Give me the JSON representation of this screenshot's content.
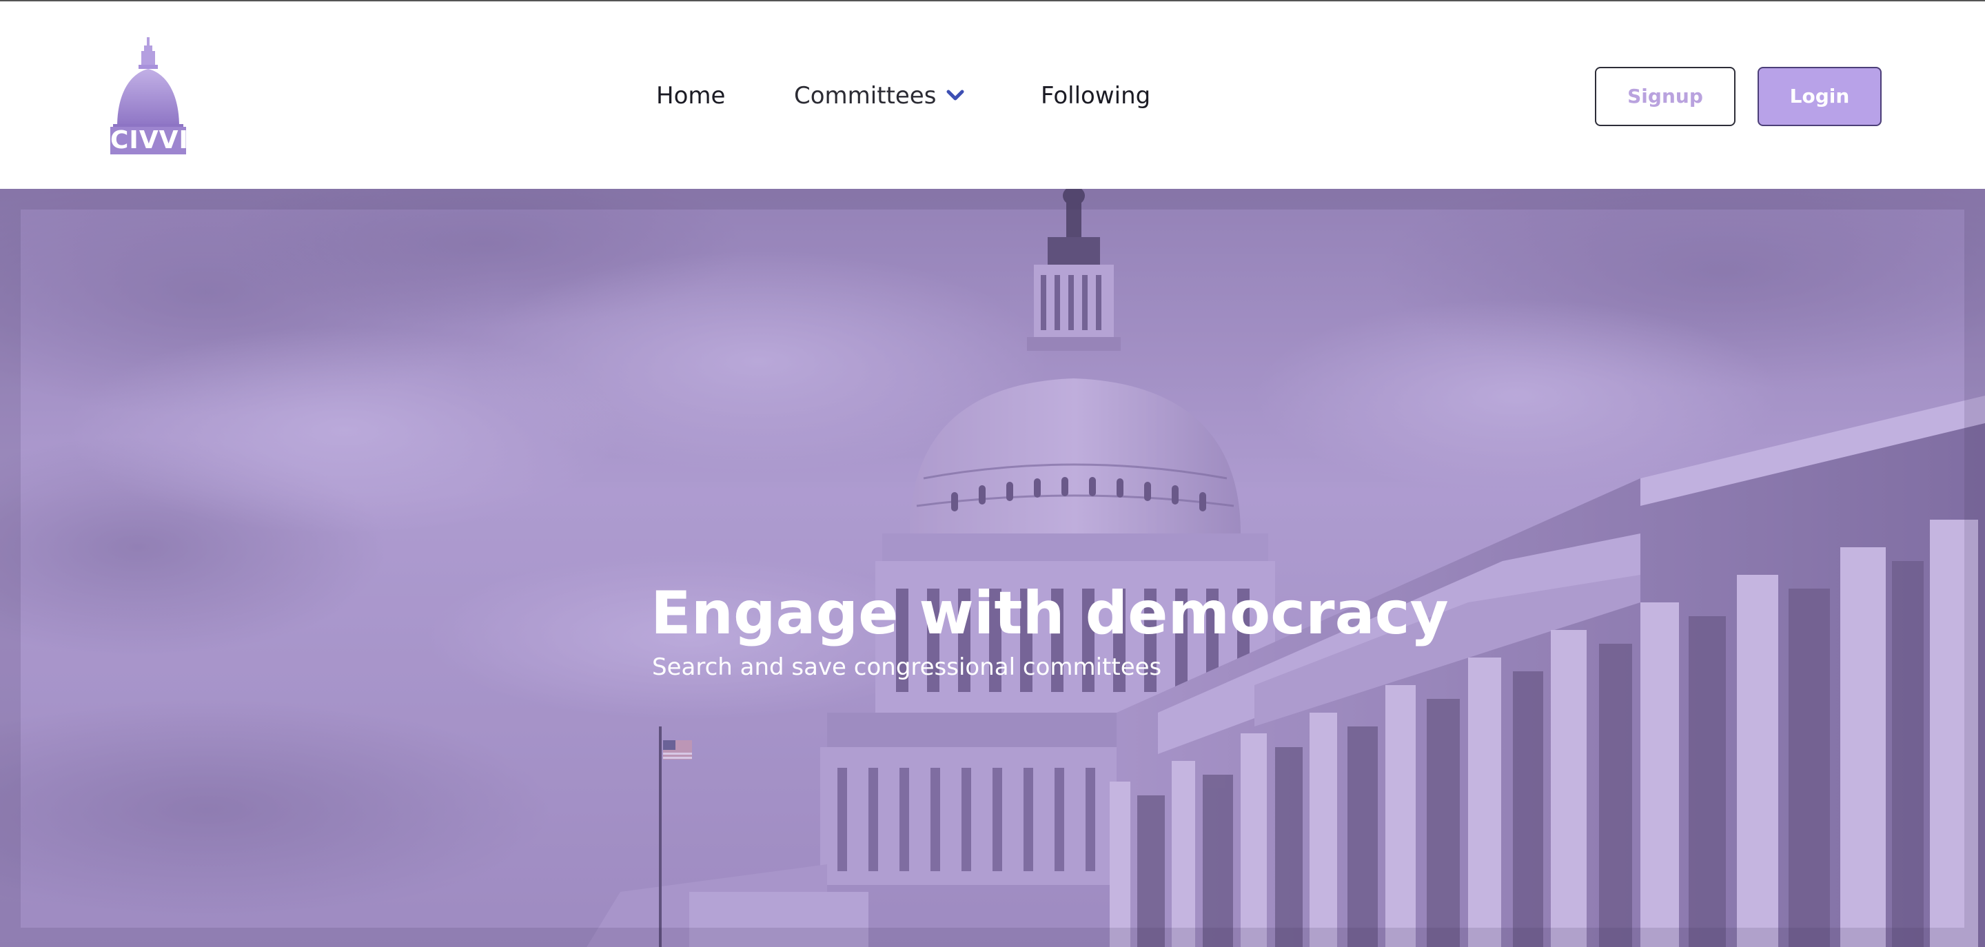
{
  "brand": {
    "logo_text": "CIVVI",
    "color": "#9d85cf"
  },
  "nav": {
    "home": "Home",
    "committees": "Committees",
    "committees_icon": "chevron-down-icon",
    "following": "Following"
  },
  "auth": {
    "signup": "Signup",
    "login": "Login"
  },
  "hero": {
    "title": "Engage with democracy",
    "subtitle": "Search and save congressional committees",
    "overlay_color": "#a58fd0",
    "image_subject": "capitol-building"
  },
  "colors": {
    "accent": "#b8a2e8",
    "chevron": "#3d4fb3",
    "text_dark": "#1b1b24"
  }
}
